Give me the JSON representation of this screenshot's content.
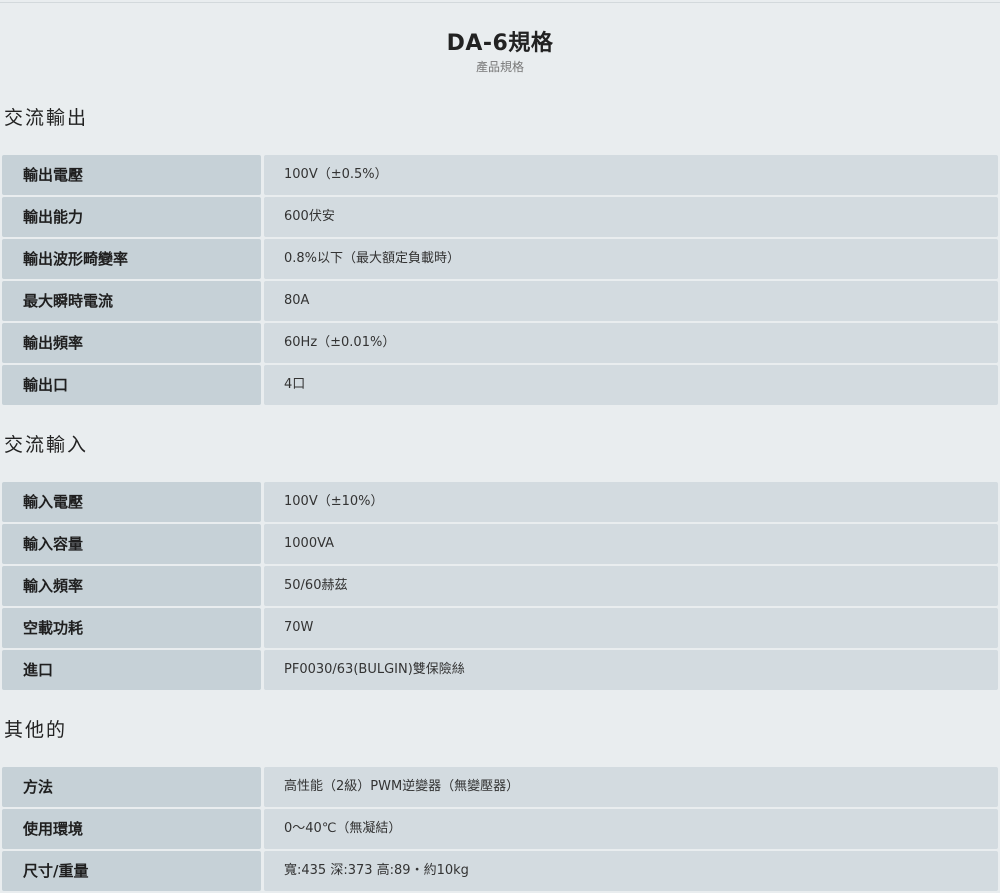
{
  "header": {
    "title": "DA-6規格",
    "subtitle": "產品規格"
  },
  "sections": [
    {
      "heading": "交流輸出",
      "rows": [
        {
          "label": "輸出電壓",
          "value": "100V（±0.5%）"
        },
        {
          "label": "輸出能力",
          "value": "600伏安"
        },
        {
          "label": "輸出波形畸變率",
          "value": "0.8%以下（最大額定負載時）"
        },
        {
          "label": "最大瞬時電流",
          "value": "80A"
        },
        {
          "label": "輸出頻率",
          "value": "60Hz（±0.01%）"
        },
        {
          "label": "輸出口",
          "value": "4口"
        }
      ]
    },
    {
      "heading": "交流輸入",
      "rows": [
        {
          "label": "輸入電壓",
          "value": "100V（±10%）"
        },
        {
          "label": "輸入容量",
          "value": "1000VA"
        },
        {
          "label": "輸入頻率",
          "value": "50/60赫茲"
        },
        {
          "label": "空載功耗",
          "value": "70W"
        },
        {
          "label": "進口",
          "value": "PF0030/63(BULGIN)雙保險絲"
        }
      ]
    },
    {
      "heading": "其他的",
      "rows": [
        {
          "label": "方法",
          "value": "高性能（2級）PWM逆變器（無變壓器）"
        },
        {
          "label": "使用環境",
          "value": "0～40℃（無凝結）"
        },
        {
          "label": "尺寸/重量",
          "value": "寬:435 深:373 高:89・約10kg"
        }
      ]
    }
  ]
}
